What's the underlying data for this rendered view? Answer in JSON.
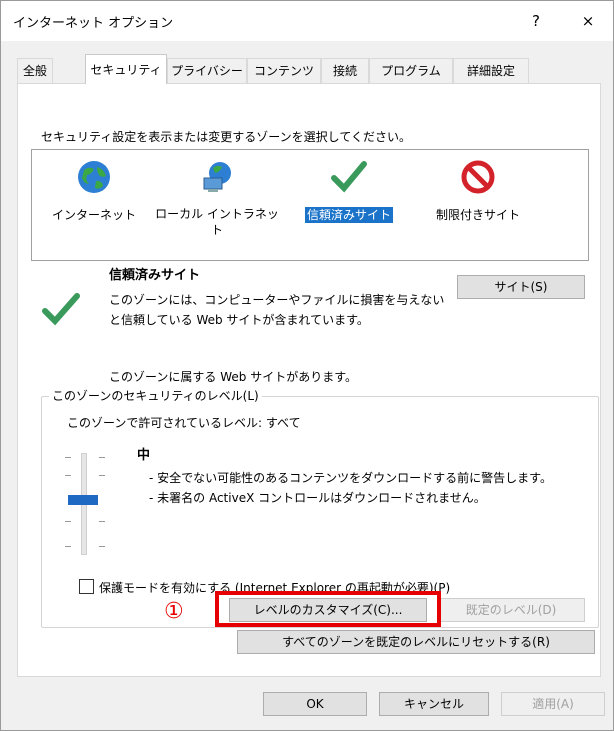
{
  "window": {
    "title": "インターネット オプション",
    "help": "?",
    "close": "×"
  },
  "tabs": [
    "全般",
    "セキュリティ",
    "プライバシー",
    "コンテンツ",
    "接続",
    "プログラム",
    "詳細設定"
  ],
  "security": {
    "instruction": "セキュリティ設定を表示または変更するゾーンを選択してください。",
    "zones": [
      {
        "label": "インターネット",
        "icon": "globe-icon"
      },
      {
        "label": "ローカル イントラネット",
        "icon": "intranet-icon"
      },
      {
        "label": "信頼済みサイト",
        "icon": "check-icon",
        "selected": true
      },
      {
        "label": "制限付きサイト",
        "icon": "prohibited-icon"
      }
    ],
    "selected_zone": {
      "name": "信頼済みサイト",
      "description_line1": "このゾーンには、コンピューターやファイルに損害を与えない",
      "description_line2": "と信頼している Web サイトが含まれています。",
      "sites_note": "このゾーンに属する Web サイトがあります。",
      "sites_button": "サイト(S)"
    },
    "level_group": {
      "title": "このゾーンのセキュリティのレベル(L)",
      "allowed": "このゾーンで許可されているレベル: すべて",
      "level_name": "中",
      "bullet1": "- 安全でない可能性のあるコンテンツをダウンロードする前に警告します。",
      "bullet2": "- 未署名の ActiveX コントロールはダウンロードされません。",
      "protected_mode": "保護モードを有効にする (Internet Explorer の再起動が必要)(P)",
      "protected_mode_checked": false,
      "custom_level_button": "レベルのカスタマイズ(C)...",
      "default_level_button": "既定のレベル(D)",
      "reset_all_button": "すべてのゾーンを既定のレベルにリセットする(R)"
    }
  },
  "annotation": {
    "marker": "①",
    "color": "#e60000"
  },
  "footer": {
    "ok": "OK",
    "cancel": "キャンセル",
    "apply": "適用(A)"
  },
  "colors": {
    "selection": "#1a73c8",
    "slider_thumb": "#1e6ac2"
  }
}
